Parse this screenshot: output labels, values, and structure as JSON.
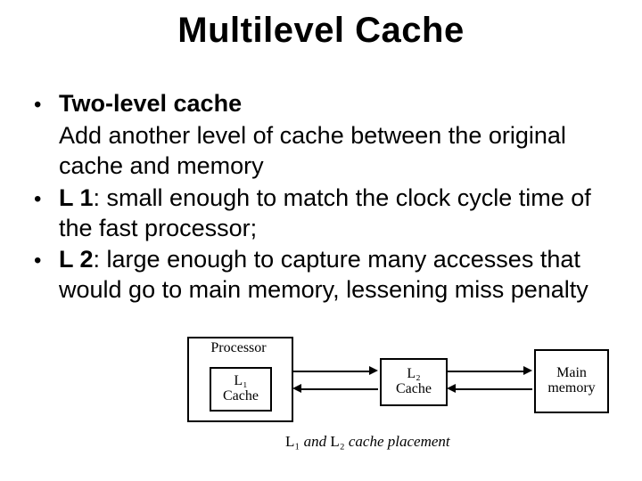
{
  "title": "Multilevel Cache",
  "bullets": {
    "b1_head": "Two-level cache",
    "b1_sub": "Add another level of cache between the original cache and memory",
    "b2_head": "L 1",
    "b2_rest": ": small enough to match the clock cycle time of the fast processor;",
    "b3_head": "L 2",
    "b3_rest": ": large enough to capture many accesses that would go to main memory, lessening miss penalty"
  },
  "diagram": {
    "processor": "Processor",
    "cache_top": "L₁",
    "cache_bot": "Cache",
    "l2_top": "L₂",
    "l2_bot": "Cache",
    "mem_top": "Main",
    "mem_bot": "memory",
    "caption_l": "L₁",
    "caption_mid": " and ",
    "caption_l2": "L₂",
    "caption_rest": " cache placement"
  }
}
